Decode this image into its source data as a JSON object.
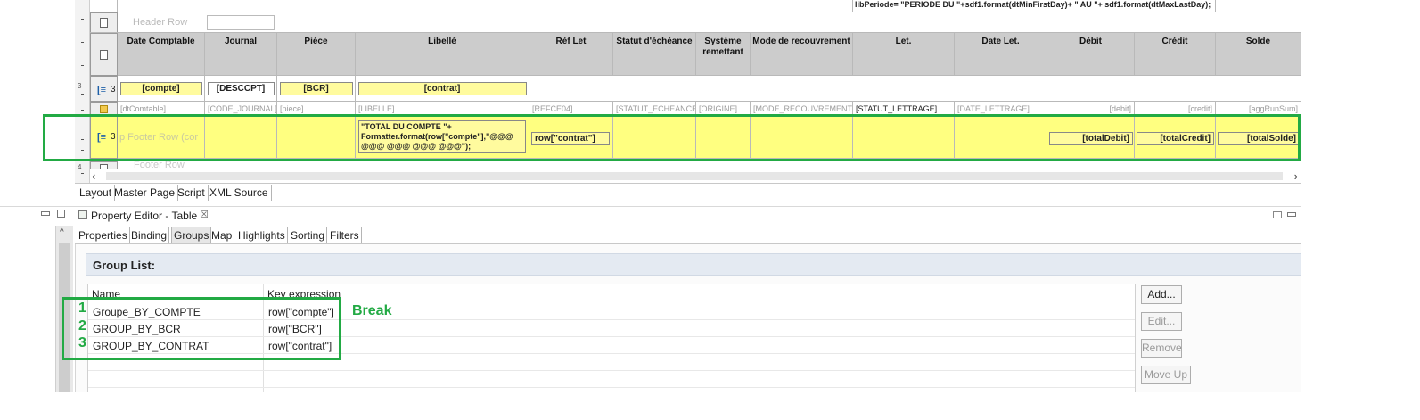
{
  "top_script_line": "libPeriode= \"PERIODE DU \"+sdf1.format(dtMinFirstDay)+ \" AU \"+ sdf1.format(dtMaxLastDay);",
  "header_row_label": "Header Row",
  "columns": [
    "Date Comptable",
    "Journal",
    "Pièce",
    "Libellé",
    "Réf Let",
    "Statut d'échéance",
    "Système remettant",
    "Mode de recouvrement",
    "Let.",
    "Date Let.",
    "Débit",
    "Crédit",
    "Solde"
  ],
  "group_row": {
    "number": "3",
    "bindings": [
      "[compte]",
      "[DESCCPT]",
      "[BCR]",
      "[contrat]"
    ]
  },
  "detail_row": {
    "placeholders": [
      "[dtComtable]",
      "[CODE_JOURNAL]",
      "[piece]",
      "[LIBELLE]",
      "[REFCE04]",
      "[STATUT_ECHEANCE]",
      "[ORIGINE]",
      "[MODE_RECOUVREMENT]",
      "[STATUT_LETTRAGE]",
      "[DATE_LETTRAGE]",
      "[debit]",
      "[credit]",
      "[aggRunSum]"
    ]
  },
  "footer_row": {
    "number": "3",
    "label": "p Footer Row (cor",
    "libelle_expr": "\"TOTAL DU COMPTE \"+ Formatter.format(row[\"compte\"],\"@@@ @@@ @@@ @@@ @@@\");",
    "reflet_expr": "row[\"contrat\"]",
    "totals": [
      "[totalDebit]",
      "[totalCredit]",
      "[totalSolde]"
    ]
  },
  "footer_row_label": "Footer Row",
  "editor_tabs": [
    "Layout",
    "Master Page",
    "Script",
    "XML Source"
  ],
  "property_editor": {
    "title": "Property Editor - Table",
    "close_glyph": "☒",
    "tabs": [
      "Properties",
      "Binding",
      "Groups",
      "Map",
      "Highlights",
      "Sorting",
      "Filters"
    ],
    "active_tab": "Groups",
    "section_title": "Group List:",
    "col_name": "Name",
    "col_key": "Key expression",
    "groups": [
      {
        "num": "1",
        "name": "Groupe_BY_COMPTE",
        "key": "row[\"compte\"]"
      },
      {
        "num": "2",
        "name": "GROUP_BY_BCR",
        "key": "row[\"BCR\"]"
      },
      {
        "num": "3",
        "name": "GROUP_BY_CONTRAT",
        "key": "row[\"contrat\"]"
      }
    ],
    "annotation": "Break",
    "buttons": {
      "add": "Add...",
      "edit": "Edit...",
      "remove": "Remove",
      "move_up": "Move Up"
    }
  },
  "colors": {
    "highlight_green": "#22aa44",
    "footer_yellow": "#ffff80",
    "header_gray": "#cccccc",
    "binding_yellow": "#fffb9e"
  }
}
